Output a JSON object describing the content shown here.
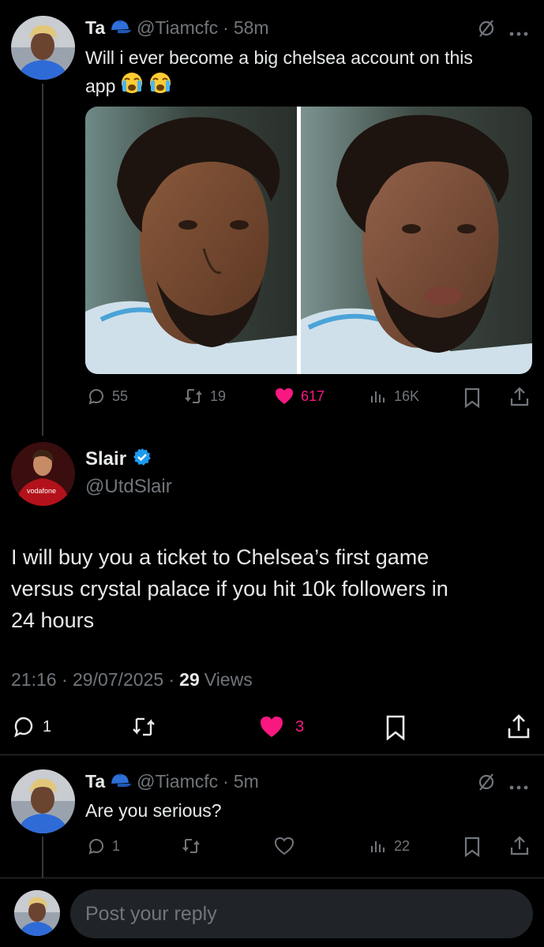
{
  "tweet1": {
    "display_name": "Ta",
    "name_emoji": "cap-emoji",
    "handle": "@Tiamcfc",
    "sep": "·",
    "time": "58m",
    "text_line1": "Will i ever become a big chelsea account on this",
    "text_line2": "app",
    "text_emoji": "crying-face-emoji",
    "actions": {
      "replies": "55",
      "retweets": "19",
      "likes": "617",
      "views": "16K"
    },
    "colors": {
      "like": "#f91880"
    }
  },
  "reply_main": {
    "display_name": "Slair",
    "verified": true,
    "handle": "@UtdSlair",
    "text_line1": "I will buy you a ticket to Chelsea’s first game",
    "text_line2": "versus crystal palace if you hit 10k followers in",
    "text_line3": "24 hours",
    "timestamp": "21:16 · 29/07/2025 ·",
    "views_count": "29",
    "views_label": "Views",
    "avatar_sponsor": "vodafone",
    "actions": {
      "replies": "1",
      "likes": "3"
    },
    "colors": {
      "verified": "#1d9bf0",
      "like": "#f91880"
    }
  },
  "tweet3": {
    "display_name": "Ta",
    "handle": "@Tiamcfc",
    "sep": "·",
    "time": "5m",
    "text": "Are you serious?",
    "actions": {
      "replies": "1",
      "views": "22"
    }
  },
  "composer": {
    "placeholder": "Post your reply"
  }
}
